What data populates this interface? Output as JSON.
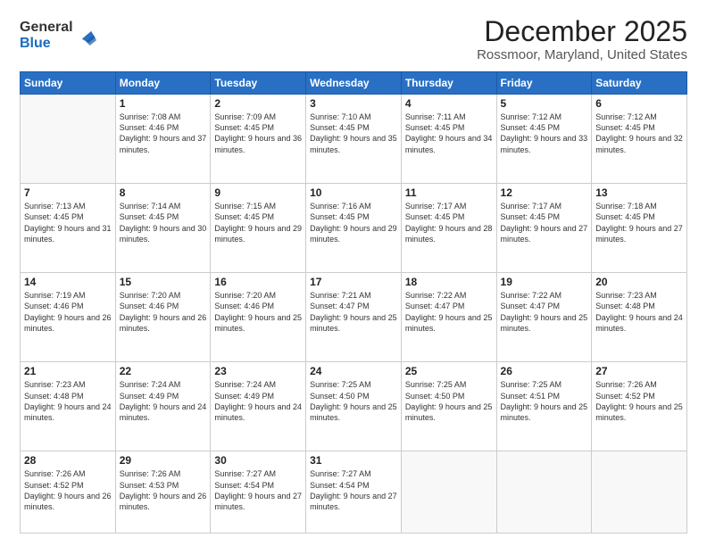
{
  "logo": {
    "general": "General",
    "blue": "Blue"
  },
  "header": {
    "title": "December 2025",
    "location": "Rossmoor, Maryland, United States"
  },
  "weekdays": [
    "Sunday",
    "Monday",
    "Tuesday",
    "Wednesday",
    "Thursday",
    "Friday",
    "Saturday"
  ],
  "weeks": [
    [
      {
        "day": "",
        "sunrise": "",
        "sunset": "",
        "daylight": ""
      },
      {
        "day": "1",
        "sunrise": "7:08 AM",
        "sunset": "4:46 PM",
        "daylight": "9 hours and 37 minutes."
      },
      {
        "day": "2",
        "sunrise": "7:09 AM",
        "sunset": "4:45 PM",
        "daylight": "9 hours and 36 minutes."
      },
      {
        "day": "3",
        "sunrise": "7:10 AM",
        "sunset": "4:45 PM",
        "daylight": "9 hours and 35 minutes."
      },
      {
        "day": "4",
        "sunrise": "7:11 AM",
        "sunset": "4:45 PM",
        "daylight": "9 hours and 34 minutes."
      },
      {
        "day": "5",
        "sunrise": "7:12 AM",
        "sunset": "4:45 PM",
        "daylight": "9 hours and 33 minutes."
      },
      {
        "day": "6",
        "sunrise": "7:12 AM",
        "sunset": "4:45 PM",
        "daylight": "9 hours and 32 minutes."
      }
    ],
    [
      {
        "day": "7",
        "sunrise": "7:13 AM",
        "sunset": "4:45 PM",
        "daylight": "9 hours and 31 minutes."
      },
      {
        "day": "8",
        "sunrise": "7:14 AM",
        "sunset": "4:45 PM",
        "daylight": "9 hours and 30 minutes."
      },
      {
        "day": "9",
        "sunrise": "7:15 AM",
        "sunset": "4:45 PM",
        "daylight": "9 hours and 29 minutes."
      },
      {
        "day": "10",
        "sunrise": "7:16 AM",
        "sunset": "4:45 PM",
        "daylight": "9 hours and 29 minutes."
      },
      {
        "day": "11",
        "sunrise": "7:17 AM",
        "sunset": "4:45 PM",
        "daylight": "9 hours and 28 minutes."
      },
      {
        "day": "12",
        "sunrise": "7:17 AM",
        "sunset": "4:45 PM",
        "daylight": "9 hours and 27 minutes."
      },
      {
        "day": "13",
        "sunrise": "7:18 AM",
        "sunset": "4:45 PM",
        "daylight": "9 hours and 27 minutes."
      }
    ],
    [
      {
        "day": "14",
        "sunrise": "7:19 AM",
        "sunset": "4:46 PM",
        "daylight": "9 hours and 26 minutes."
      },
      {
        "day": "15",
        "sunrise": "7:20 AM",
        "sunset": "4:46 PM",
        "daylight": "9 hours and 26 minutes."
      },
      {
        "day": "16",
        "sunrise": "7:20 AM",
        "sunset": "4:46 PM",
        "daylight": "9 hours and 25 minutes."
      },
      {
        "day": "17",
        "sunrise": "7:21 AM",
        "sunset": "4:47 PM",
        "daylight": "9 hours and 25 minutes."
      },
      {
        "day": "18",
        "sunrise": "7:22 AM",
        "sunset": "4:47 PM",
        "daylight": "9 hours and 25 minutes."
      },
      {
        "day": "19",
        "sunrise": "7:22 AM",
        "sunset": "4:47 PM",
        "daylight": "9 hours and 25 minutes."
      },
      {
        "day": "20",
        "sunrise": "7:23 AM",
        "sunset": "4:48 PM",
        "daylight": "9 hours and 24 minutes."
      }
    ],
    [
      {
        "day": "21",
        "sunrise": "7:23 AM",
        "sunset": "4:48 PM",
        "daylight": "9 hours and 24 minutes."
      },
      {
        "day": "22",
        "sunrise": "7:24 AM",
        "sunset": "4:49 PM",
        "daylight": "9 hours and 24 minutes."
      },
      {
        "day": "23",
        "sunrise": "7:24 AM",
        "sunset": "4:49 PM",
        "daylight": "9 hours and 24 minutes."
      },
      {
        "day": "24",
        "sunrise": "7:25 AM",
        "sunset": "4:50 PM",
        "daylight": "9 hours and 25 minutes."
      },
      {
        "day": "25",
        "sunrise": "7:25 AM",
        "sunset": "4:50 PM",
        "daylight": "9 hours and 25 minutes."
      },
      {
        "day": "26",
        "sunrise": "7:25 AM",
        "sunset": "4:51 PM",
        "daylight": "9 hours and 25 minutes."
      },
      {
        "day": "27",
        "sunrise": "7:26 AM",
        "sunset": "4:52 PM",
        "daylight": "9 hours and 25 minutes."
      }
    ],
    [
      {
        "day": "28",
        "sunrise": "7:26 AM",
        "sunset": "4:52 PM",
        "daylight": "9 hours and 26 minutes."
      },
      {
        "day": "29",
        "sunrise": "7:26 AM",
        "sunset": "4:53 PM",
        "daylight": "9 hours and 26 minutes."
      },
      {
        "day": "30",
        "sunrise": "7:27 AM",
        "sunset": "4:54 PM",
        "daylight": "9 hours and 27 minutes."
      },
      {
        "day": "31",
        "sunrise": "7:27 AM",
        "sunset": "4:54 PM",
        "daylight": "9 hours and 27 minutes."
      },
      {
        "day": "",
        "sunrise": "",
        "sunset": "",
        "daylight": ""
      },
      {
        "day": "",
        "sunrise": "",
        "sunset": "",
        "daylight": ""
      },
      {
        "day": "",
        "sunrise": "",
        "sunset": "",
        "daylight": ""
      }
    ]
  ]
}
